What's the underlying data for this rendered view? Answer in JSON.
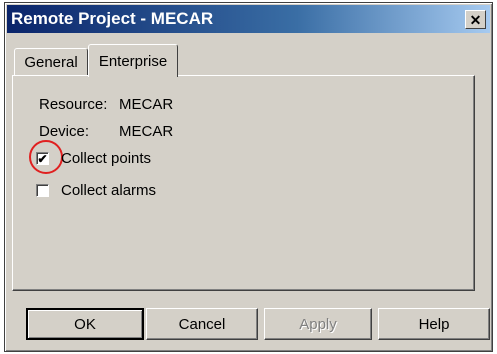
{
  "window": {
    "title": "Remote Project - MECAR",
    "close_glyph": "✕"
  },
  "tabs": [
    {
      "label": "General",
      "active": false
    },
    {
      "label": "Enterprise",
      "active": true
    }
  ],
  "info": {
    "resource_label": "Resource:",
    "resource_value": "MECAR",
    "device_label": "Device:",
    "device_value": "MECAR"
  },
  "checkboxes": {
    "collect_points": {
      "label": "Collect points",
      "checked": true,
      "mark": "✔"
    },
    "collect_alarms": {
      "label": "Collect alarms",
      "checked": false,
      "mark": ""
    }
  },
  "buttons": {
    "ok": "OK",
    "cancel": "Cancel",
    "apply": "Apply",
    "help": "Help"
  },
  "colors": {
    "titlebar_start": "#0a246a",
    "dialog_bg": "#d4d0c8",
    "highlight": "#e02020"
  }
}
